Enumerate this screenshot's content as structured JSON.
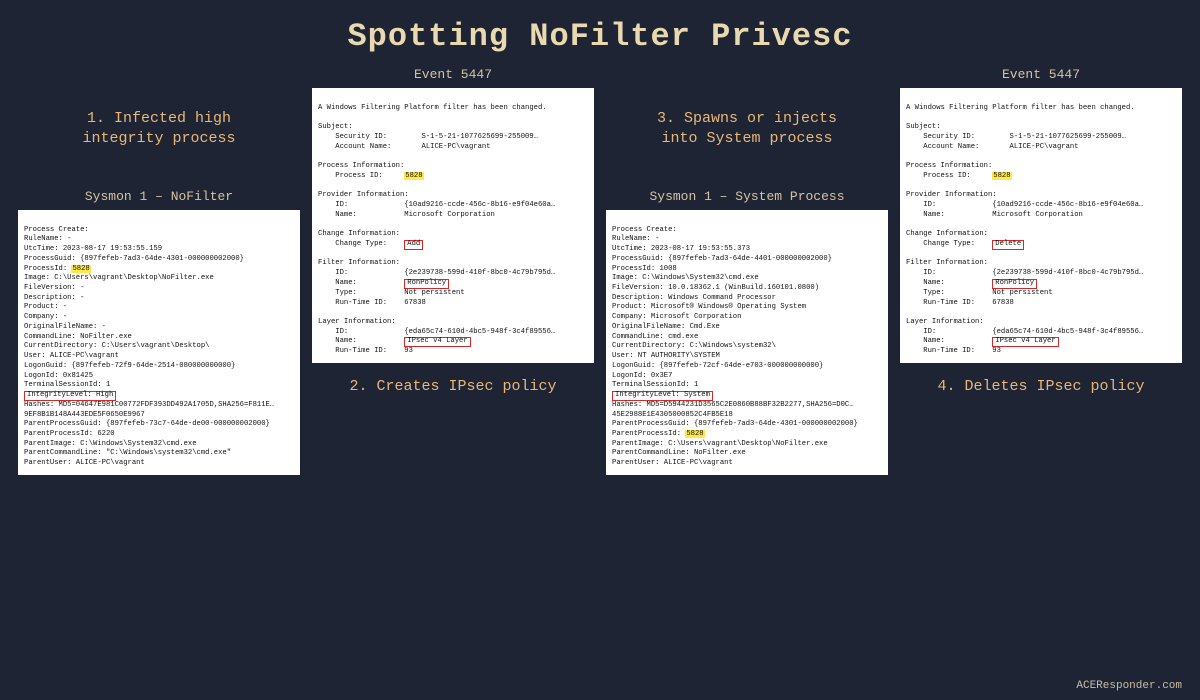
{
  "title": "Spotting NoFilter Privesc",
  "footer": "ACEResponder.com",
  "steps": {
    "s1": "1. Infected high\nintegrity process",
    "s2": "2. Creates IPsec policy",
    "s3": "3. Spawns or injects\ninto System process",
    "s4": "4. Deletes IPsec policy"
  },
  "panels": {
    "sysmon1": {
      "title": "Sysmon 1 – NoFilter",
      "header": "Process Create:",
      "fields": {
        "RuleName": "-",
        "UtcTime": "2023-08-17 19:53:55.159",
        "ProcessGuid": "{897fefeb-7ad3-64de-4301-000000002000}",
        "ProcessId": "5828",
        "Image": "C:\\Users\\vagrant\\Desktop\\NoFilter.exe",
        "FileVersion": "-",
        "Description": "-",
        "Product": "-",
        "Company": "-",
        "OriginalFileName": "-",
        "CommandLine": "NoFilter.exe",
        "CurrentDirectory": "C:\\Users\\vagrant\\Desktop\\",
        "User": "ALICE-PC\\vagrant",
        "LogonGuid": "{897fefeb-72f9-64de-2514-080000000000}",
        "LogonId": "0x81425",
        "TerminalSessionId": "1",
        "IntegrityLevel": "High",
        "Hashes": "MD5=04647E981C00772FDF393DD492A1705D,SHA256=F811E…\n9EF8B1B148A443EDE5F0650E9967",
        "ParentProcessGuid": "{897fefeb-73c7-64de-de00-000000002000}",
        "ParentProcessId": "6220",
        "ParentImage": "C:\\Windows\\System32\\cmd.exe",
        "ParentCommandLine": "\"C:\\Windows\\system32\\cmd.exe\"",
        "ParentUser": "ALICE-PC\\vagrant"
      }
    },
    "event5447_add": {
      "title": "Event 5447",
      "header": "A Windows Filtering Platform filter has been changed.",
      "subject": {
        "SecurityID": "S-1-5-21-1077625699-255009…",
        "AccountName": "ALICE-PC\\vagrant"
      },
      "processInfo": {
        "ProcessID": "5828"
      },
      "providerInfo": {
        "ID": "{10ad9216-ccde-456c-8b16-e9f04e60a…",
        "Name": "Microsoft Corporation"
      },
      "changeInfo": {
        "ChangeType": "Add"
      },
      "filterInfo": {
        "ID": "{2e239738-599d-410f-8bc0-4c79b795d…",
        "Name": "RonPolicy",
        "Type": "Not persistent",
        "RunTimeID": "67838"
      },
      "layerInfo": {
        "ID": "{eda65c74-610d-4bc5-948f-3c4f89556…",
        "Name": "IPsec v4 Layer",
        "RunTimeID": "93"
      }
    },
    "sysmon2": {
      "title": "Sysmon 1 – System Process",
      "header": "Process Create:",
      "fields": {
        "RuleName": "-",
        "UtcTime": "2023-08-17 19:53:55.373",
        "ProcessGuid": "{897fefeb-7ad3-64de-4401-000000002000}",
        "ProcessId": "1008",
        "Image": "C:\\Windows\\System32\\cmd.exe",
        "FileVersion": "10.0.18362.1 (WinBuild.160101.0800)",
        "Description": "Windows Command Processor",
        "Product": "Microsoft® Windows® Operating System",
        "Company": "Microsoft Corporation",
        "OriginalFileName": "Cmd.Exe",
        "CommandLine": "cmd.exe",
        "CurrentDirectory": "C:\\Windows\\system32\\",
        "User": "NT AUTHORITY\\SYSTEM",
        "LogonGuid": "{897fefeb-72cf-64de-e703-000000000000}",
        "LogonId": "0x3E7",
        "TerminalSessionId": "1",
        "IntegrityLevel": "System",
        "Hashes": "MD5=D5944231D3565C2E0860B88BF32B2277,SHA256=D0C…\n45E2988E1E4305000852C4FB5E18",
        "ParentProcessGuid": "{897fefeb-7ad3-64de-4301-000000002000}",
        "ParentProcessId": "5828",
        "ParentImage": "C:\\Users\\vagrant\\Desktop\\NoFilter.exe",
        "ParentCommandLine": "NoFilter.exe",
        "ParentUser": "ALICE-PC\\vagrant"
      }
    },
    "event5447_del": {
      "title": "Event 5447",
      "header": "A Windows Filtering Platform filter has been changed.",
      "subject": {
        "SecurityID": "S-1-5-21-1077625699-255009…",
        "AccountName": "ALICE-PC\\vagrant"
      },
      "processInfo": {
        "ProcessID": "5828"
      },
      "providerInfo": {
        "ID": "{10ad9216-ccde-456c-8b16-e9f04e60a…",
        "Name": "Microsoft Corporation"
      },
      "changeInfo": {
        "ChangeType": "Delete"
      },
      "filterInfo": {
        "ID": "{2e239738-599d-410f-8bc0-4c79b795d…",
        "Name": "RonPolicy",
        "Type": "Not persistent",
        "RunTimeID": "67838"
      },
      "layerInfo": {
        "ID": "{eda65c74-610d-4bc5-948f-3c4f89556…",
        "Name": "IPsec v4 Layer",
        "RunTimeID": "93"
      }
    }
  }
}
